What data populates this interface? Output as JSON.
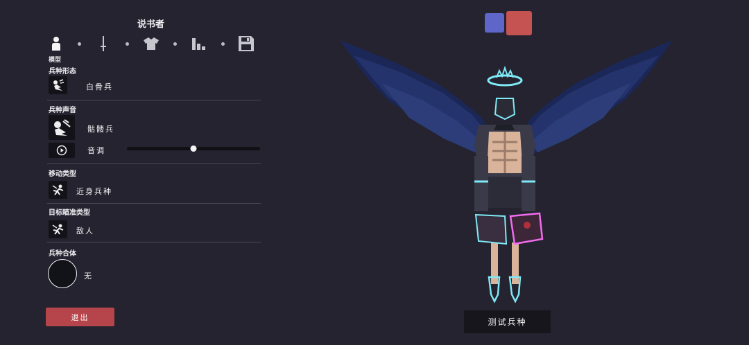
{
  "unit_name": "说书者",
  "tabs": [
    {
      "icon": "person-icon",
      "selected": true
    },
    {
      "icon": "sword-icon",
      "selected": false
    },
    {
      "icon": "shirt-icon",
      "selected": false
    },
    {
      "icon": "bar-stats-icon",
      "selected": false
    },
    {
      "icon": "save-disk-icon",
      "selected": false
    }
  ],
  "selected_tab_label": "模型",
  "sections": {
    "form": {
      "label": "兵种形态",
      "value": "白骨兵",
      "icon": "skeleton-icon"
    },
    "voice": {
      "label": "兵种声音",
      "value": "骷髅兵",
      "icon": "skeleton-voice-icon",
      "pitch_label": "音调",
      "pitch_level": 0.5,
      "play_icon": "play-icon"
    },
    "movement": {
      "label": "移动类型",
      "value": "近身兵种",
      "icon": "melee-run-icon"
    },
    "targeting": {
      "label": "目标瞄准类型",
      "value": "敌人",
      "icon": "target-enemy-icon"
    },
    "combination": {
      "label": "兵种合体",
      "value": "无"
    }
  },
  "exit_label": "退出",
  "test_label": "测试兵种",
  "team_colors": {
    "blue": "#5e66c9",
    "red": "#c55352"
  },
  "preview_icon": "winged-skeleton-preview"
}
